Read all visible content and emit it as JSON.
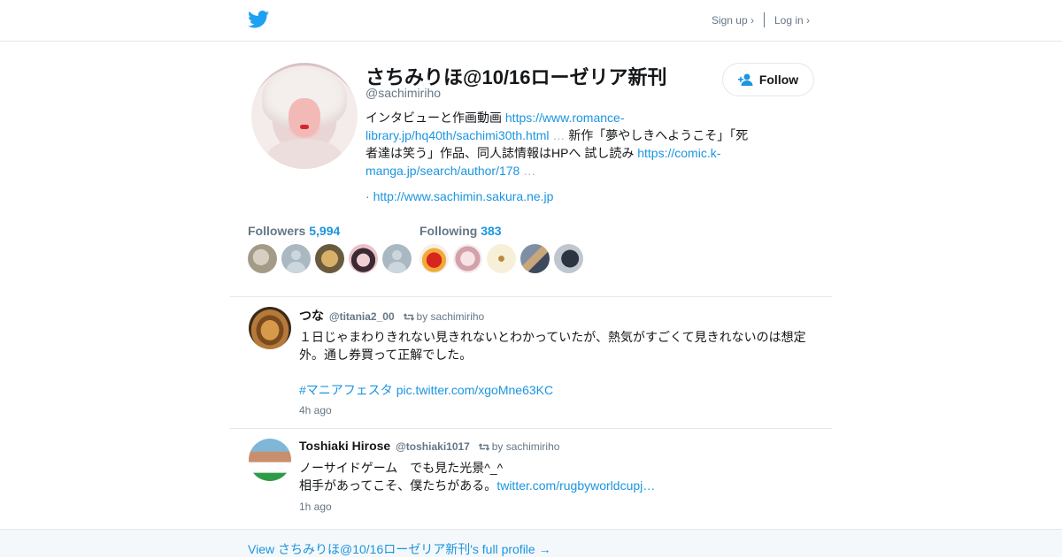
{
  "nav": {
    "signup": "Sign up ›",
    "login": "Log in ›"
  },
  "profile": {
    "name": "さちみりほ@10/16ローゼリア新刊",
    "handle": "@sachimiriho",
    "follow_label": "Follow",
    "bio": {
      "part1": "インタビューと作画動画 ",
      "link1": "https://www.romance-library.jp/hq40th/sachimi30th.html",
      "ellipsis1": " …",
      "part2": " 新作「夢やしきへようこそ」「死者達は笑う」作品、同人誌情報はHPへ 試し読み ",
      "link2": "https://comic.k-manga.jp/search/author/178",
      "ellipsis2": " …"
    },
    "website_prefix": "· ",
    "website": "http://www.sachimin.sakura.ne.jp"
  },
  "followers": {
    "label": "Followers",
    "count": "5,994"
  },
  "following": {
    "label": "Following",
    "count": "383"
  },
  "tweets": [
    {
      "name": "つな",
      "handle": "@titania2_00",
      "retweet_by": "by sachimiriho",
      "line1": "１日じゃまわりきれない見きれないとわかっていたが、熱気がすごくて見きれないのは想定外。通し券買って正解でした。",
      "hashtag": "#マニアフェスタ",
      "link": "pic.twitter.com/xgoMne63KC",
      "time": "4h ago"
    },
    {
      "name": "Toshiaki Hirose",
      "handle": "@toshiaki1017",
      "retweet_by": "by sachimiriho",
      "line1": "ノーサイドゲーム　でも見た光景^_^",
      "line2": "相手があってこそ、僕たちがある。",
      "link": "twitter.com/rugbyworldcupj…",
      "time": "1h ago"
    }
  ],
  "footer": {
    "link": "View さちみりほ@10/16ローゼリア新刊's full profile →"
  },
  "colors": {
    "accent": "#1b95e0",
    "muted": "#657786",
    "border": "#e1e8ed"
  },
  "icons": {
    "logo": "twitter-bird-icon",
    "follow": "add-user-icon",
    "retweet": "retweet-icon"
  }
}
